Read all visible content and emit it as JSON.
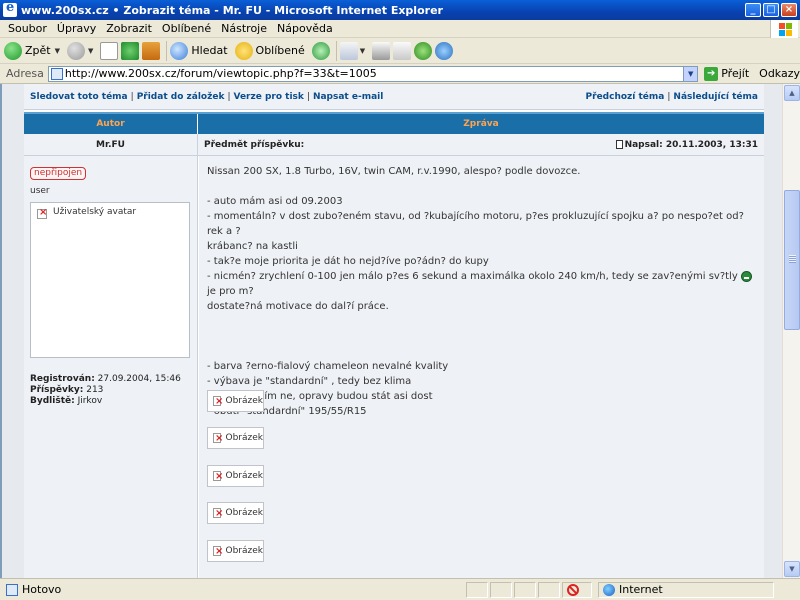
{
  "window": {
    "title": "www.200sx.cz • Zobrazit téma - Mr. FU - Microsoft Internet Explorer",
    "minimize": "_",
    "maximize": "□",
    "close": "×"
  },
  "menu": [
    "Soubor",
    "Úpravy",
    "Zobrazit",
    "Oblíbené",
    "Nástroje",
    "Nápověda"
  ],
  "toolbar": {
    "back_label": "Zpět",
    "search_label": "Hledat",
    "favorites_label": "Oblíbené"
  },
  "address": {
    "label": "Adresa",
    "url": "http://www.200sx.cz/forum/viewtopic.php?f=33&t=1005",
    "go_label": "Přejít",
    "links_label": "Odkazy"
  },
  "forum": {
    "nav_left": [
      "Sledovat toto téma",
      "Přidat do záložek",
      "Verze pro tisk",
      "Napsat e-mail"
    ],
    "nav_right": [
      "Předchozí téma",
      "Následující téma"
    ],
    "col_author": "Autor",
    "col_message": "Zpráva"
  },
  "post": {
    "author": "Mr.FU",
    "subject_label": "Předmět příspěvku:",
    "posted": "Napsal: 20.11.2003, 13:31",
    "status_badge": "nepřipojen",
    "rank": "user",
    "avatar_alt": "Uživatelský avatar",
    "registered_label": "Registrován:",
    "registered_value": "27.09.2004, 15:46",
    "posts_label": "Příspěvky:",
    "posts_value": "213",
    "location_label": "Bydliště:",
    "location_value": "Jirkov",
    "body": {
      "intro": "Nissan 200 SX, 1.8 Turbo, 16V, twin CAM, r.v.1990, alespo? podle dovozce.",
      "lines_a": [
        "- auto mám asi od 09.2003",
        "- momentáln? v dost zubo?eném stavu, od ?kubajícího motoru, p?es prokluzující spojku a? po nespo?et od?rek a ?",
        "krábanc? na kastli",
        "- tak?e moje priorita je dát ho nejd?íve po?ádn? do kupy"
      ],
      "line_smiley_before": "- nicmén? zrychlení 0-100 jen málo p?es 6 sekund a maximálka okolo 240 km/h, tedy se zav?enými sv?tly",
      "line_smiley_after": " je pro m?",
      "line_last_a": "dostate?ná motivace do dal?í práce.",
      "lines_b": [
        "- barva ?erno-fialový chameleon nevalné kvality",
        "- výbava je \"standardní\" , tedy bez klima",
        "- tuning zatím ne, opravy budou stát asi dost",
        "- obutí \"standardní\" 195/55/R15"
      ],
      "images": [
        "Obrázek",
        "Obrázek",
        "Obrázek",
        "Obrázek",
        "Obrázek"
      ]
    }
  },
  "statusbar": {
    "status": "Hotovo",
    "zone": "Internet"
  }
}
